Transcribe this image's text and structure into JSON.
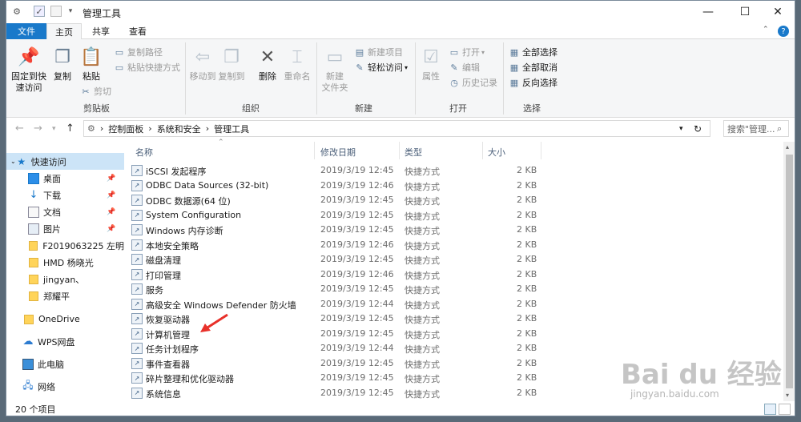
{
  "window": {
    "title": "管理工具"
  },
  "ribbon_tabs": {
    "file": "文件",
    "home": "主页",
    "share": "共享",
    "view": "查看"
  },
  "ribbon": {
    "pin": "固定到快\n速访问",
    "pin1": "固定到快",
    "pin2": "速访问",
    "copy": "复制",
    "paste": "粘贴",
    "copy_path": "复制路径",
    "paste_shortcut": "粘贴快捷方式",
    "cut": "剪切",
    "group_clipboard": "剪贴板",
    "move_to": "移动到",
    "copy_to": "复制到",
    "delete": "删除",
    "rename": "重命名",
    "group_organize": "组织",
    "new_folder1": "新建",
    "new_folder2": "文件夹",
    "new_item": "新建项目",
    "easy_access": "轻松访问",
    "group_new": "新建",
    "properties": "属性",
    "open": "打开",
    "edit": "编辑",
    "history": "历史记录",
    "group_open": "打开",
    "select_all": "全部选择",
    "select_none": "全部取消",
    "invert": "反向选择",
    "group_select": "选择"
  },
  "address": {
    "crumbs": [
      "控制面板",
      "系统和安全",
      "管理工具"
    ],
    "search_placeholder": "搜索\"管理..."
  },
  "sidebar": {
    "quick_access": "快速访问",
    "items": [
      {
        "label": "桌面",
        "icon": "desktop-icon",
        "pinned": true
      },
      {
        "label": "下载",
        "icon": "download-icon",
        "pinned": true
      },
      {
        "label": "文档",
        "icon": "document-icon",
        "pinned": true
      },
      {
        "label": "图片",
        "icon": "picture-icon",
        "pinned": true
      },
      {
        "label": "F2019063225 左明",
        "icon": "folder-icon"
      },
      {
        "label": "HMD 杨晓光",
        "icon": "folder-icon"
      },
      {
        "label": "jingyan、",
        "icon": "folder-icon"
      },
      {
        "label": "郑耀平",
        "icon": "folder-icon"
      }
    ],
    "onedrive": "OneDrive",
    "wps": "WPS网盘",
    "this_pc": "此电脑",
    "network": "网络"
  },
  "columns": {
    "name": "名称",
    "modified": "修改日期",
    "type": "类型",
    "size": "大小"
  },
  "files": [
    {
      "name": "iSCSI 发起程序",
      "date": "2019/3/19 12:45",
      "type": "快捷方式",
      "size": "2 KB"
    },
    {
      "name": "ODBC Data Sources (32-bit)",
      "date": "2019/3/19 12:46",
      "type": "快捷方式",
      "size": "2 KB"
    },
    {
      "name": "ODBC 数据源(64 位)",
      "date": "2019/3/19 12:45",
      "type": "快捷方式",
      "size": "2 KB"
    },
    {
      "name": "System Configuration",
      "date": "2019/3/19 12:45",
      "type": "快捷方式",
      "size": "2 KB"
    },
    {
      "name": "Windows 内存诊断",
      "date": "2019/3/19 12:45",
      "type": "快捷方式",
      "size": "2 KB"
    },
    {
      "name": "本地安全策略",
      "date": "2019/3/19 12:46",
      "type": "快捷方式",
      "size": "2 KB"
    },
    {
      "name": "磁盘清理",
      "date": "2019/3/19 12:45",
      "type": "快捷方式",
      "size": "2 KB"
    },
    {
      "name": "打印管理",
      "date": "2019/3/19 12:46",
      "type": "快捷方式",
      "size": "2 KB"
    },
    {
      "name": "服务",
      "date": "2019/3/19 12:45",
      "type": "快捷方式",
      "size": "2 KB"
    },
    {
      "name": "高级安全 Windows Defender 防火墙",
      "date": "2019/3/19 12:44",
      "type": "快捷方式",
      "size": "2 KB"
    },
    {
      "name": "恢复驱动器",
      "date": "2019/3/19 12:45",
      "type": "快捷方式",
      "size": "2 KB"
    },
    {
      "name": "计算机管理",
      "date": "2019/3/19 12:45",
      "type": "快捷方式",
      "size": "2 KB"
    },
    {
      "name": "任务计划程序",
      "date": "2019/3/19 12:44",
      "type": "快捷方式",
      "size": "2 KB"
    },
    {
      "name": "事件查看器",
      "date": "2019/3/19 12:45",
      "type": "快捷方式",
      "size": "2 KB"
    },
    {
      "name": "碎片整理和优化驱动器",
      "date": "2019/3/19 12:45",
      "type": "快捷方式",
      "size": "2 KB"
    },
    {
      "name": "系统信息",
      "date": "2019/3/19 12:45",
      "type": "快捷方式",
      "size": "2 KB"
    }
  ],
  "status": {
    "count": "20 个项目"
  },
  "watermark": {
    "logo": "Bai du 经验",
    "url": "jingyan.baidu.com"
  },
  "colors": {
    "accent": "#1979ca",
    "arrow": "#e8312a"
  }
}
